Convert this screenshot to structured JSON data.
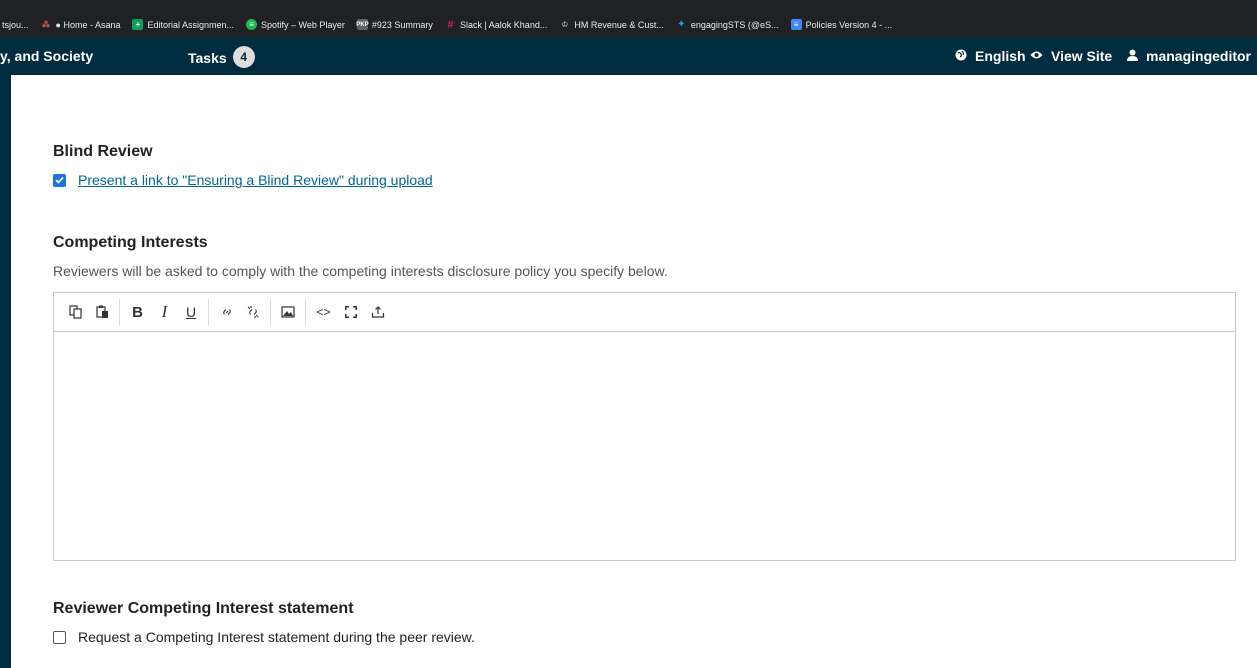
{
  "bookmarks": [
    {
      "label": "tsjou...",
      "icon": "tab-fragment",
      "color": "#202124"
    },
    {
      "label": "● Home - Asana",
      "icon": "asana-icon",
      "color": "#f06a6a"
    },
    {
      "label": "Editorial Assignmen...",
      "icon": "sheets-icon",
      "color": "#0f9d58"
    },
    {
      "label": "Spotify – Web Player",
      "icon": "spotify-icon",
      "color": "#1db954"
    },
    {
      "label": "#923 Summary",
      "icon": "pkp-icon",
      "color": "#5f6368"
    },
    {
      "label": "Slack | Aalok Khand...",
      "icon": "slack-icon",
      "color": "#e01e5a"
    },
    {
      "label": "HM Revenue & Cust...",
      "icon": "crown-icon",
      "color": "#202124"
    },
    {
      "label": "engagingSTS (@eS...",
      "icon": "twitter-icon",
      "color": "#1da1f2"
    },
    {
      "label": "Policies Version 4 - ...",
      "icon": "docs-icon",
      "color": "#4285f4"
    }
  ],
  "header": {
    "context_title": "y, and Society",
    "tasks_label": "Tasks",
    "tasks_count": "4",
    "language_label": "English",
    "view_site_label": "View Site",
    "user_label": "managingeditor"
  },
  "blind_review": {
    "title": "Blind Review",
    "link_label": "Present a link to \"Ensuring a Blind Review\" during upload",
    "checked": true
  },
  "competing_interests": {
    "title": "Competing Interests",
    "description": "Reviewers will be asked to comply with the competing interests disclosure policy you specify below.",
    "content": ""
  },
  "toolbar": {
    "buttons": [
      "copy-icon",
      "paste-icon",
      "bold-icon",
      "italic-icon",
      "underline-icon",
      "link-icon",
      "unlink-icon",
      "image-icon",
      "code-icon",
      "fullscreen-icon",
      "upload-icon"
    ]
  },
  "reviewer_statement": {
    "title": "Reviewer Competing Interest statement",
    "checkbox_label": "Request a Competing Interest statement during the peer review.",
    "checked": false
  },
  "colors": {
    "header_bg": "#002c40",
    "link": "#006798",
    "checkbox_checked": "#1a73e8"
  }
}
